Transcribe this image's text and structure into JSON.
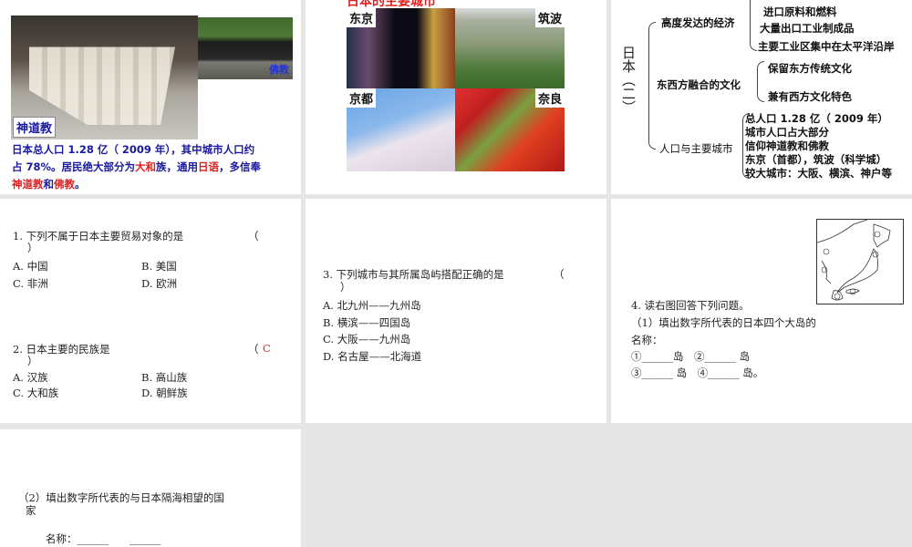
{
  "slide1": {
    "label_shinto": "神道教",
    "label_buddhism": "佛教",
    "caption": {
      "part1": "日本总人口 1.28 亿（ 2009 年），其中城市人口约占 78%。居民绝大部分为",
      "yamato": "大和",
      "part2": "族，通用",
      "japanese": "日语",
      "part3": "，多信奉",
      "shinto": "神道教",
      "part4": "和",
      "buddhism": "佛教",
      "part5": "。"
    }
  },
  "slide2": {
    "title": "日本的主要城市",
    "cities": [
      "东京",
      "筑波",
      "京都",
      "奈良"
    ]
  },
  "slide3": {
    "root": "日本（二）",
    "branches": [
      {
        "label": "高度发达的经济",
        "items": [
          "进口原料和燃料",
          "大量出口工业制成品",
          "主要工业区集中在太平洋沿岸"
        ]
      },
      {
        "label": "东西方融合的文化",
        "items": [
          "保留东方传统文化",
          "兼有西方文化特色"
        ]
      },
      {
        "label": "人口与主要城市",
        "items": [
          "总人口 1.28 亿（ 2009 年）",
          "城市人口占大部分",
          "信仰神道教和佛教",
          "东京（首都），筑波（科学城）",
          "较大城市：大阪、横滨、神户等"
        ]
      }
    ]
  },
  "slide4": {
    "q1": {
      "stem": "1. 下列不属于日本主要贸易对象的是",
      "paren_open": "（",
      "answer": "",
      "paren_close": "）",
      "options": [
        "A. 中国",
        "B. 美国",
        "C. 非洲",
        "D. 欧洲"
      ]
    },
    "q2": {
      "stem": "2. 日本主要的民族是",
      "paren_open": "（",
      "answer": "C",
      "paren_close": "）",
      "options": [
        "A. 汉族",
        "B. 高山族",
        "C. 大和族",
        "D. 朝鲜族"
      ]
    }
  },
  "slide5": {
    "q3": {
      "stem": "3. 下列城市与其所属岛屿搭配正确的是",
      "paren_open": "（",
      "paren_close": "）",
      "options": [
        "A. 北九州——九州岛",
        "B. 横滨——四国岛",
        "C. 大阪——九州岛",
        "D. 名古屋——北海道"
      ]
    }
  },
  "slide6": {
    "stem": "4. 读右图回答下列问题。",
    "sub1": "（1）填出数字所代表的日本四个大岛的",
    "sub1b": "名称：",
    "line1": "①______岛　②______ 岛",
    "line2": "③______ 岛　④______ 岛。"
  },
  "slide7": {
    "sub2": "（2）填出数字所代表的与日本隔海相望的国",
    "sub2b": "家",
    "names": "名称：______　　______"
  }
}
